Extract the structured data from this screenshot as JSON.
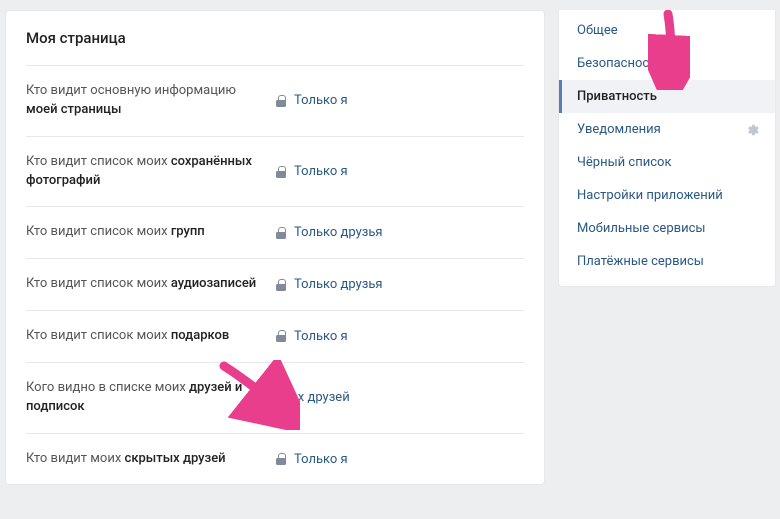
{
  "main": {
    "title": "Моя страница",
    "rows": [
      {
        "label_pre": "Кто видит основную информацию ",
        "label_bold": "моей страницы",
        "value": "Только я",
        "lock": true
      },
      {
        "label_pre": "Кто видит список моих ",
        "label_bold": "сохранённых фотографий",
        "value": "Только я",
        "lock": true
      },
      {
        "label_pre": "Кто видит список моих ",
        "label_bold": "групп",
        "value": "Только друзья",
        "lock": true
      },
      {
        "label_pre": "Кто видит список моих ",
        "label_bold": "аудиозаписей",
        "value": "Только друзья",
        "lock": true
      },
      {
        "label_pre": "Кто видит список моих ",
        "label_bold": "подарков",
        "value": "Только я",
        "lock": true
      },
      {
        "label_pre": "Кого видно в списке моих ",
        "label_bold": "друзей и подписок",
        "value": "Всех друзей",
        "lock": false
      },
      {
        "label_pre": "Кто видит моих ",
        "label_bold": "скрытых друзей",
        "value": "Только я",
        "lock": true
      }
    ]
  },
  "sidebar": {
    "items": [
      {
        "label": "Общее",
        "active": false,
        "gear": false
      },
      {
        "label": "Безопасность",
        "active": false,
        "gear": false
      },
      {
        "label": "Приватность",
        "active": true,
        "gear": false
      },
      {
        "label": "Уведомления",
        "active": false,
        "gear": true
      },
      {
        "label": "Чёрный список",
        "active": false,
        "gear": false
      },
      {
        "label": "Настройки приложений",
        "active": false,
        "gear": false
      },
      {
        "label": "Мобильные сервисы",
        "active": false,
        "gear": false
      },
      {
        "label": "Платёжные сервисы",
        "active": false,
        "gear": false
      }
    ]
  },
  "annotations": {
    "arrow_color": "#e83e8c"
  }
}
